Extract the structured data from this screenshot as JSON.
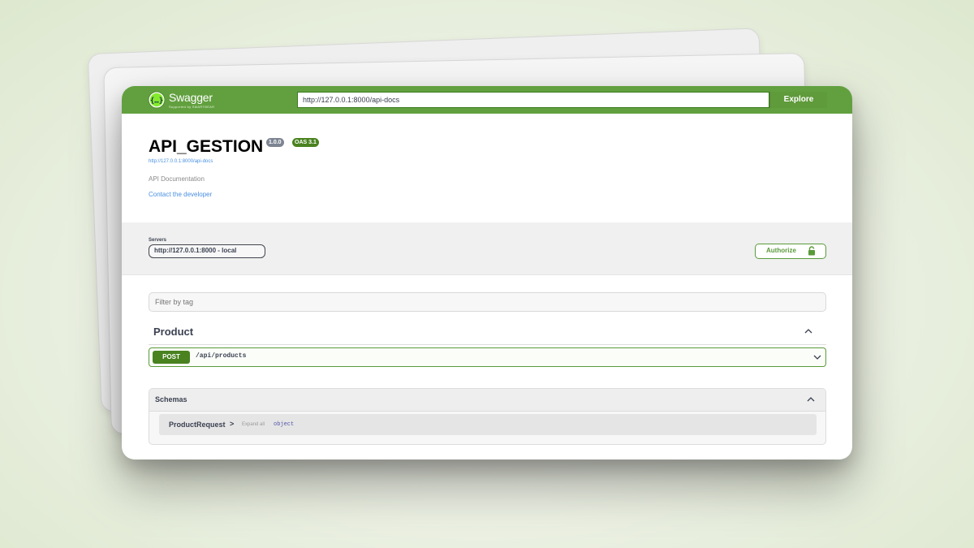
{
  "header": {
    "brand": "Swagger",
    "brand_sub": "Supported by SMARTBEAR",
    "url_value": "http://127.0.0.1:8000/api-docs",
    "explore_label": "Explore",
    "brand_color": "#62a03f"
  },
  "info": {
    "title": "API_GESTION",
    "version": "1.0.0",
    "oas": "OAS 3.1",
    "spec_url": "http://127.0.0.1:8000/api-docs",
    "description": "API Documentation",
    "contact": "Contact the developer"
  },
  "servers": {
    "label": "Servers",
    "selected": "http://127.0.0.1:8000 - local",
    "authorize_label": "Authorize"
  },
  "filter": {
    "placeholder": "Filter by tag"
  },
  "tags": [
    {
      "name": "Product",
      "operations": [
        {
          "method": "POST",
          "path": "/api/products",
          "method_color": "#49821f"
        }
      ]
    }
  ],
  "schemas": {
    "title": "Schemas",
    "models": [
      {
        "name": "ProductRequest",
        "arrow": ">",
        "expand": "Expand all",
        "type": "object"
      }
    ]
  }
}
